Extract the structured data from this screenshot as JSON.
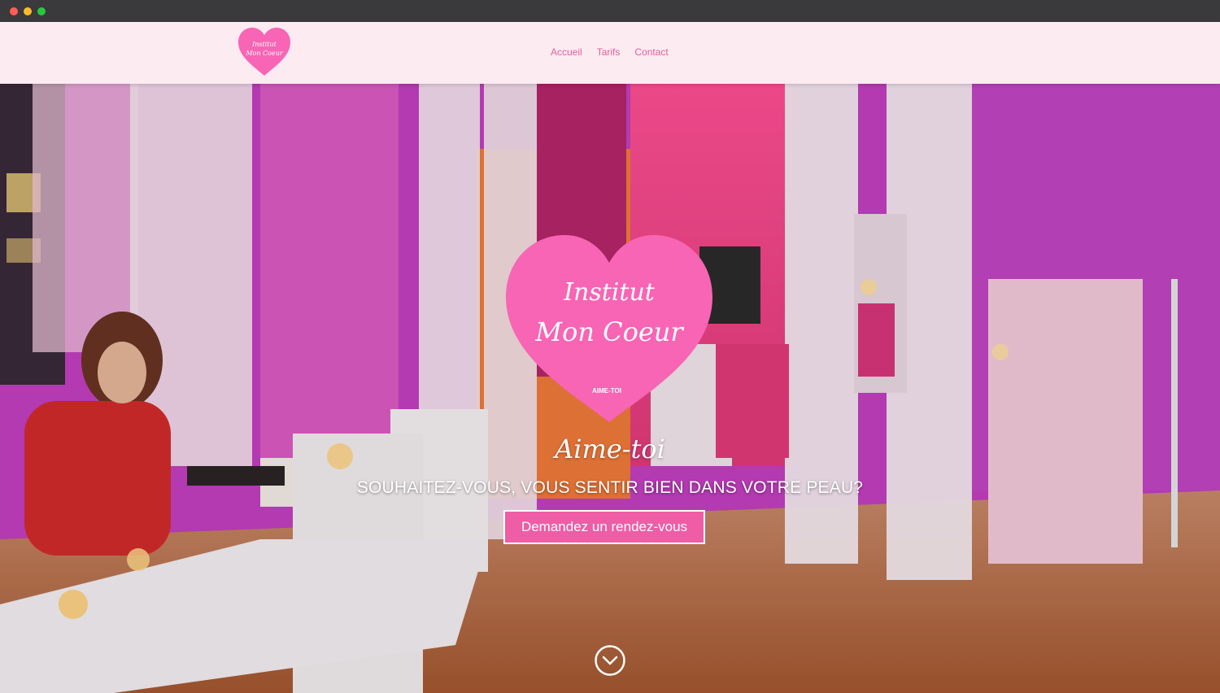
{
  "header": {
    "logo_line1": "Institut",
    "logo_line2": "Mon Coeur",
    "nav": [
      {
        "label": "Accueil"
      },
      {
        "label": "Tarifs"
      },
      {
        "label": "Contact"
      }
    ]
  },
  "hero": {
    "logo_line1": "Institut",
    "logo_line2": "Mon Coeur",
    "logo_tagline": "AIME-TOI",
    "script_tagline": "Aime-toi",
    "subtitle": "SOUHAITEZ-VOUS, VOUS SENTIR BIEN DANS VOTRE PEAU?",
    "cta_label": "Demandez un rendez-vous",
    "scroll_icon": "chevron-down-circle-icon"
  },
  "colors": {
    "header_bg": "#fdebf2",
    "nav_link": "#e0609a",
    "heart": "#f765b4",
    "cta_bg": "#ee5da6"
  }
}
